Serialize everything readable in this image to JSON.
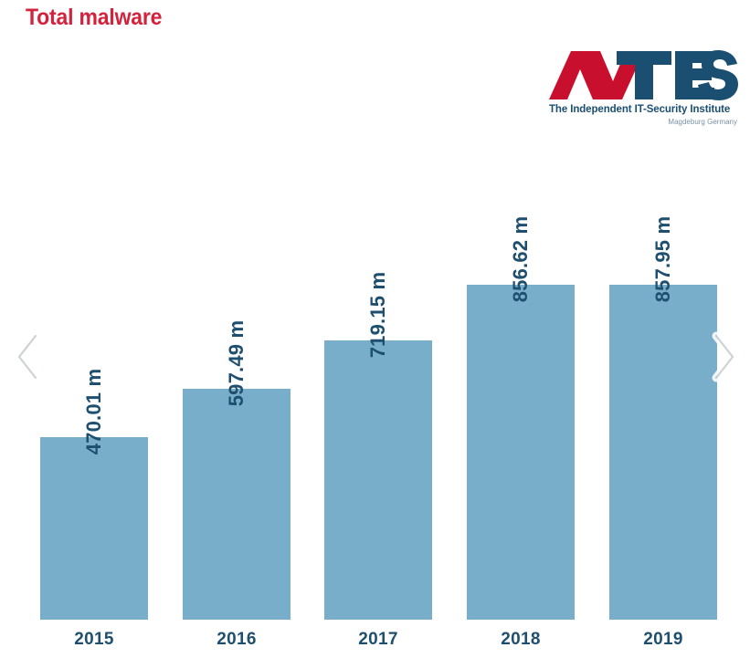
{
  "header": {
    "title": "Total malware"
  },
  "logo": {
    "name": "av-test-logo",
    "mark_av": "AV",
    "mark_test": "TEST",
    "tagline": "The Independent IT-Security Institute",
    "location": "Magdeburg Germany",
    "color_red": "#C8102E",
    "color_blue": "#1B4F72"
  },
  "controls": {
    "prev_label": "Previous",
    "prev_icon": "chevron-left-icon",
    "next_label": "Next",
    "next_icon": "chevron-right-icon"
  },
  "colors": {
    "bar": "#79AECB",
    "label_text": "#1F4F6E",
    "title": "#D4213C",
    "background": "#FFFFFF"
  },
  "chart_data": {
    "type": "bar",
    "title": "Total malware",
    "xlabel": "",
    "ylabel": "",
    "unit": "m",
    "unit_meaning": "million",
    "grid": false,
    "legend": false,
    "ylim": [
      0,
      900
    ],
    "categories": [
      "2015",
      "2016",
      "2017",
      "2018",
      "2019"
    ],
    "values": [
      470.01,
      597.49,
      719.15,
      856.62,
      857.95
    ],
    "value_labels": [
      "470.01 m",
      "597.49 m",
      "719.15 m",
      "856.62 m",
      "857.95 m"
    ],
    "bars": [
      {
        "category": "2015",
        "value": 470.01,
        "label": "470.01 m"
      },
      {
        "category": "2016",
        "value": 597.49,
        "label": "597.49 m"
      },
      {
        "category": "2017",
        "value": 719.15,
        "label": "719.15 m"
      },
      {
        "category": "2018",
        "value": 856.62,
        "label": "856.62 m"
      },
      {
        "category": "2019",
        "value": 857.95,
        "label": "857.95 m"
      }
    ]
  }
}
